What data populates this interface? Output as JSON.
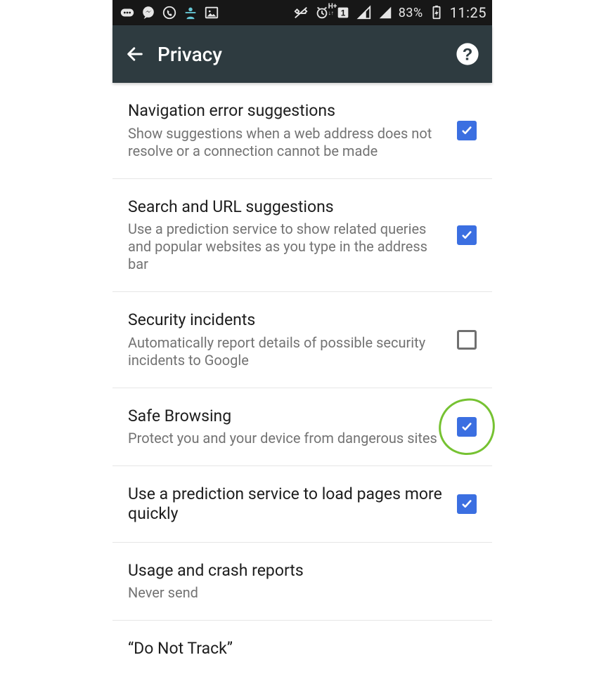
{
  "statusbar": {
    "battery_pct": "83%",
    "time": "11:25",
    "icons": {
      "messaging": "messaging-icon",
      "messenger": "messenger-icon",
      "viber": "viber-icon",
      "person": "person-icon",
      "gallery": "image-icon",
      "mute": "vibrate-icon",
      "alarm": "alarm-icon",
      "network_type": "H+",
      "sim_slot": "1",
      "signal1": "signal-icon",
      "signal2": "signal-icon",
      "charging": "charging-icon"
    }
  },
  "appbar": {
    "title": "Privacy"
  },
  "settings": [
    {
      "id": "navigation-error",
      "title": "Navigation error suggestions",
      "desc": "Show suggestions when a web address does not resolve or a connection cannot be made",
      "type": "checkbox",
      "checked": true
    },
    {
      "id": "search-url-suggestions",
      "title": "Search and URL suggestions",
      "desc": "Use a prediction service to show related queries and popular websites as you type in the address bar",
      "type": "checkbox",
      "checked": true
    },
    {
      "id": "security-incidents",
      "title": "Security incidents",
      "desc": "Automatically report details of possible security incidents to Google",
      "type": "checkbox",
      "checked": false
    },
    {
      "id": "safe-browsing",
      "title": "Safe Browsing",
      "desc": "Protect you and your device from dangerous sites",
      "type": "checkbox",
      "checked": true,
      "annotated": true
    },
    {
      "id": "prediction-preload",
      "title": "Use a prediction service to load pages more quickly",
      "desc": "",
      "type": "checkbox",
      "checked": true
    },
    {
      "id": "usage-crash-reports",
      "title": "Usage and crash reports",
      "desc": "Never send",
      "type": "link"
    },
    {
      "id": "do-not-track",
      "title": "“Do Not Track”",
      "desc": "",
      "type": "link"
    }
  ]
}
